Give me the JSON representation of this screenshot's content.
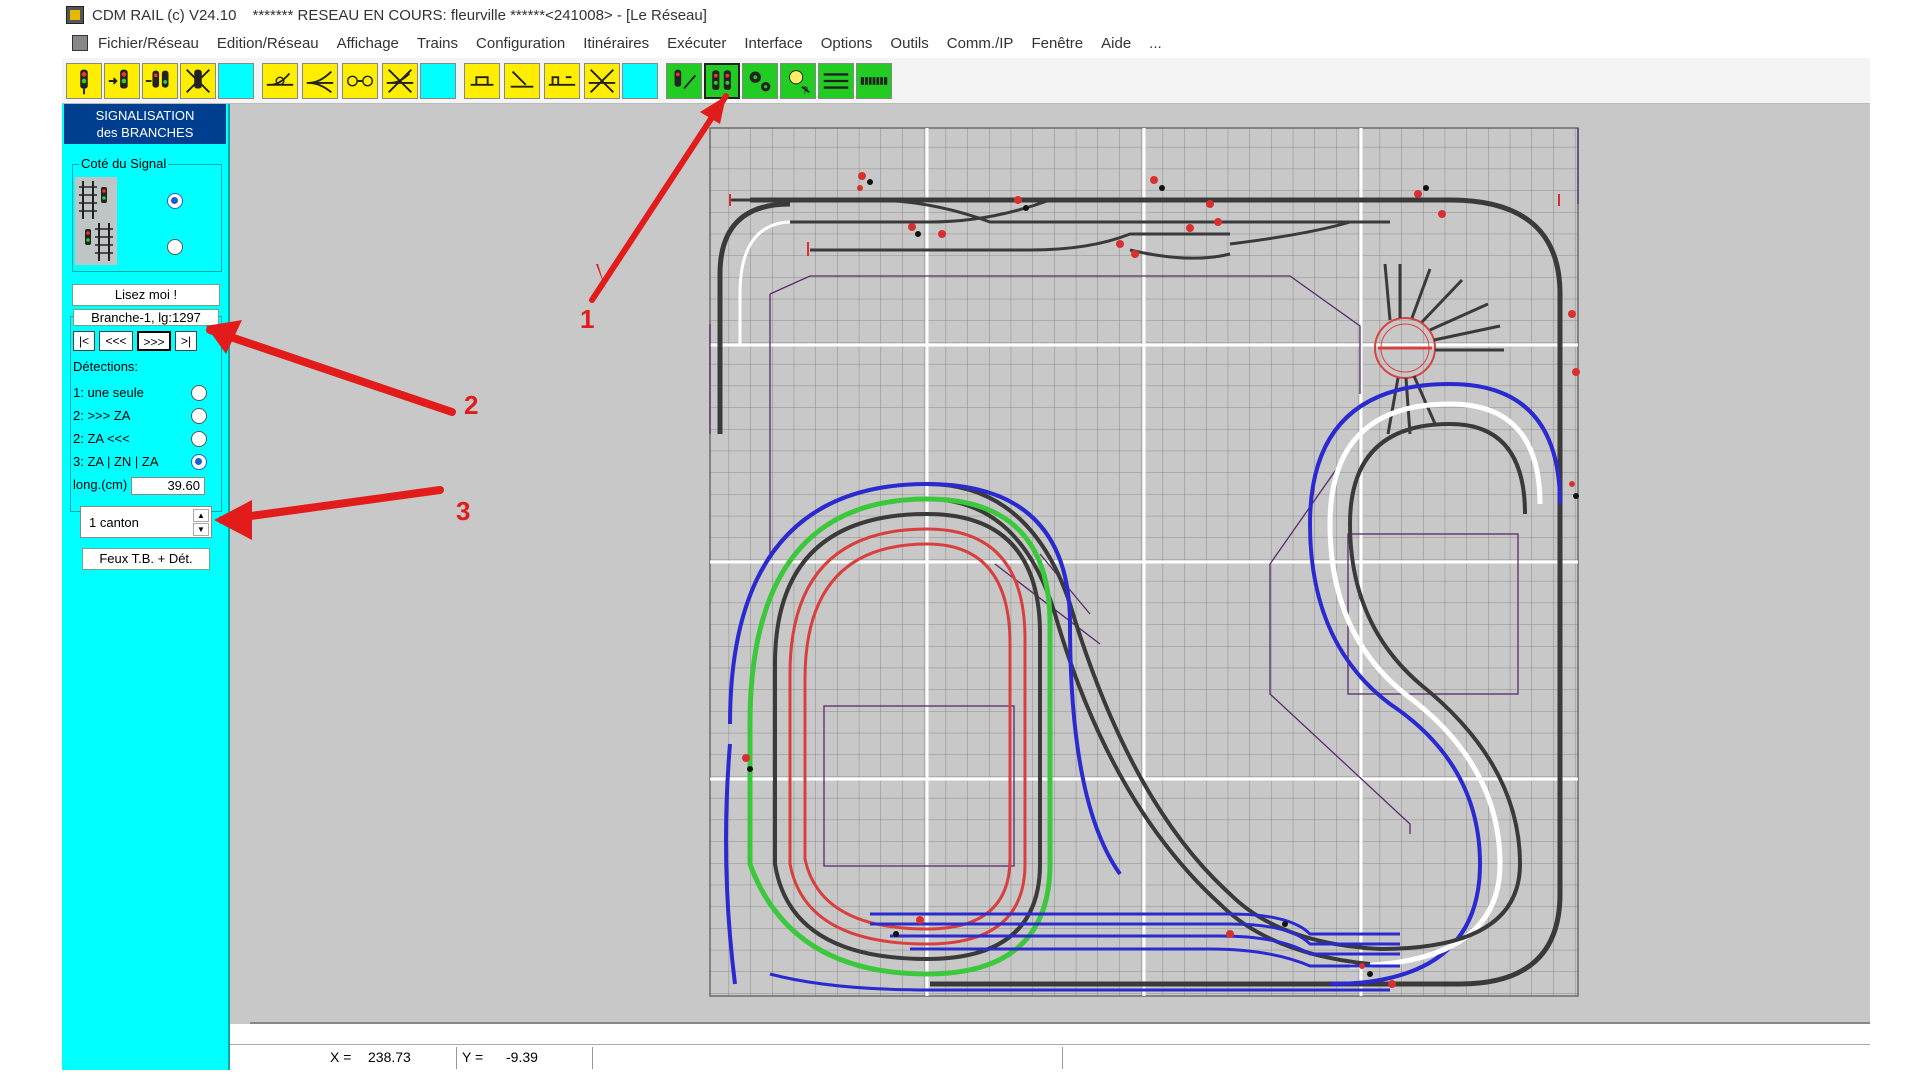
{
  "window": {
    "title": "CDM RAIL (c) V24.10",
    "subtitle": "******* RESEAU EN COURS: fleurville ******<241008> - [Le Réseau]"
  },
  "menu": {
    "items": [
      "Fichier/Réseau",
      "Edition/Réseau",
      "Affichage",
      "Trains",
      "Configuration",
      "Itinéraires",
      "Exécuter",
      "Interface",
      "Options",
      "Outils",
      "Comm./IP",
      "Fenêtre",
      "Aide",
      "..."
    ]
  },
  "toolbar": {
    "buttons": [
      {
        "icon": "signal-single-icon"
      },
      {
        "icon": "signal-arrow-icon"
      },
      {
        "icon": "signal-double-icon"
      },
      {
        "icon": "signal-cross-icon"
      },
      {
        "icon": "blank-icon"
      },
      {
        "icon": "turnout-icon"
      },
      {
        "icon": "turnout-double-icon"
      },
      {
        "icon": "turnout-group-icon"
      },
      {
        "icon": "turnout-cross-icon"
      },
      {
        "icon": "blank-icon"
      },
      {
        "icon": "bumper-icon"
      },
      {
        "icon": "bumper-angle-icon"
      },
      {
        "icon": "bumper-pair-icon"
      },
      {
        "icon": "track-cross-icon"
      },
      {
        "icon": "blank-icon"
      },
      {
        "icon": "signal-green-icon"
      },
      {
        "icon": "branch-signal-icon"
      },
      {
        "icon": "gears-icon"
      },
      {
        "icon": "query-icon"
      },
      {
        "icon": "lines-icon"
      },
      {
        "icon": "grid-bar-icon"
      }
    ]
  },
  "panel": {
    "header_line1": "SIGNALISATION",
    "header_line2": "des BRANCHES",
    "signal_side_title": "Coté du Signal",
    "readme_label": "Lisez moi !",
    "branch_title": "Branche-1, lg:1297",
    "nav": [
      "|<",
      "<<<",
      ">>>",
      ">|"
    ],
    "detections_title": "Détections:",
    "detections": [
      {
        "label": "1: une seule",
        "checked": false
      },
      {
        "label": "2: >>>  ZA",
        "checked": false
      },
      {
        "label": "2: ZA  <<<",
        "checked": false
      },
      {
        "label": "3: ZA | ZN | ZA",
        "checked": true
      }
    ],
    "length_label": "long.(cm)",
    "length_value": "39.60",
    "canton_value": "1 canton",
    "lights_button": "Feux T.B. + Dét."
  },
  "status": {
    "x_label": "X =",
    "x_value": "238.73",
    "y_label": "Y =",
    "y_value": "-9.39"
  },
  "annotations": {
    "label1": "1",
    "label2": "2",
    "label3": "3",
    "color": "#e21b1b"
  },
  "colors": {
    "panel_bg": "#00ffff",
    "header_bg": "#003f8f",
    "canvas_bg": "#c8c8c8",
    "track_dark": "#3a3a3a",
    "track_blue": "#2a2ad0",
    "track_green": "#3cc83c",
    "track_red": "#d84040",
    "layout_outline": "#5a2a6a"
  }
}
